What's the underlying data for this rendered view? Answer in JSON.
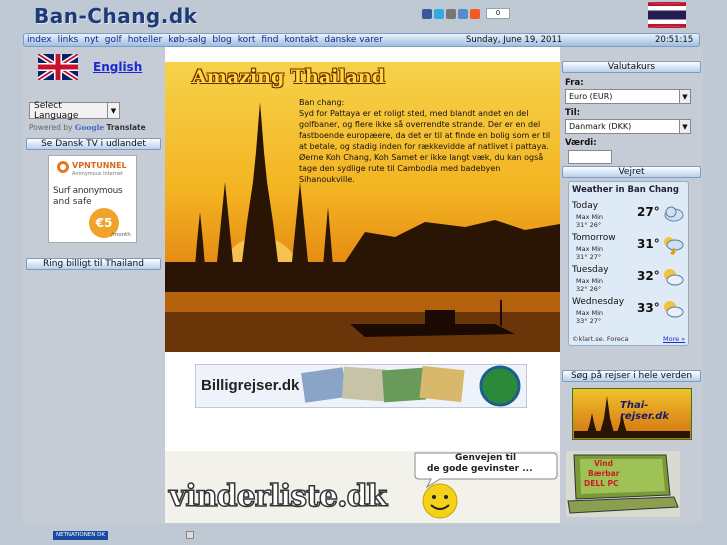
{
  "header": {
    "logo": "Ban-Chang.dk",
    "share_count": "0"
  },
  "nav": {
    "links": [
      "index",
      "links",
      "nyt",
      "golf",
      "hoteller",
      "køb-salg",
      "blog",
      "kort",
      "find",
      "kontakt",
      "danske varer"
    ],
    "date": "Sunday, June 19, 2011",
    "time": "20:51:15"
  },
  "left": {
    "language_link": "English",
    "select_language": "Select Language",
    "powered_by": "Powered by",
    "google": "Google",
    "translate": "Translate",
    "se_dansk_tv": "Se Dansk TV i udlandet",
    "vpn_ad": {
      "brand": "VPNTUNNEL",
      "tagline": "Anonymous Internet",
      "line1": "Surf anonymous",
      "line2": "and safe",
      "price": "€5",
      "per": "/month"
    },
    "ring_billigt": "Ring billigt til Thailand"
  },
  "center": {
    "hero_title": "Amazing Thailand",
    "hero_heading": "Ban chang:",
    "hero_text": "Syd for Pattaya er et roligt sted, med blandt andet en del golfbaner, og flere ikke så overrendte strande. Der er en del fastboende europæere, da det er til at finde en bolig som er til at betale, og stadig inden for rækkevidde af natlivet i pattaya. Øerne Koh Chang, Koh Samet er ikke langt væk, du kan også tage den sydlige rute til Cambodia med badebyen Sihanoukville.",
    "billig_ad": "Billigrejser.dk",
    "vinder_ad": "vinderliste.dk",
    "vinder_bubble_1": "Genvejen til",
    "vinder_bubble_2": "de gode gevinster ..."
  },
  "right": {
    "valutakurs": "Valutakurs",
    "fra_label": "Fra:",
    "fra_value": "Euro (EUR)",
    "til_label": "Til:",
    "til_value": "Danmark (DKK)",
    "vaerdi_label": "Værdi:",
    "vejret": "Vejret",
    "weather_title": "Weather in Ban Chang",
    "maxmin": "Max Min",
    "days": [
      {
        "day": "Today",
        "temp": "27°",
        "max": "31°",
        "min": "26°",
        "icon": "cloud-icon"
      },
      {
        "day": "Tomorrow",
        "temp": "31°",
        "max": "31°",
        "min": "27°",
        "icon": "thunderstorm-icon"
      },
      {
        "day": "Tuesday",
        "temp": "32°",
        "max": "32°",
        "min": "26°",
        "icon": "partly-sunny-icon"
      },
      {
        "day": "Wednesday",
        "temp": "33°",
        "max": "33°",
        "min": "27°",
        "icon": "partly-sunny-icon"
      }
    ],
    "credit": "©klart.se. Foreca",
    "more": "More »",
    "sog_pa_rejser": "Søg på rejser i hele verden",
    "thai_ad": "Thai-rejser.dk",
    "laptop_ad_1": "Vind",
    "laptop_ad_2": "Bærbar",
    "laptop_ad_3": "DELL PC"
  },
  "footer": {
    "badge": "NETNATIONEN DK"
  },
  "colors": {
    "brand_blue": "#1e3a78",
    "link_blue": "#1a2ad0",
    "nav_gradient_top": "#e9f2fb",
    "nav_gradient_bottom": "#9fbfe2"
  }
}
